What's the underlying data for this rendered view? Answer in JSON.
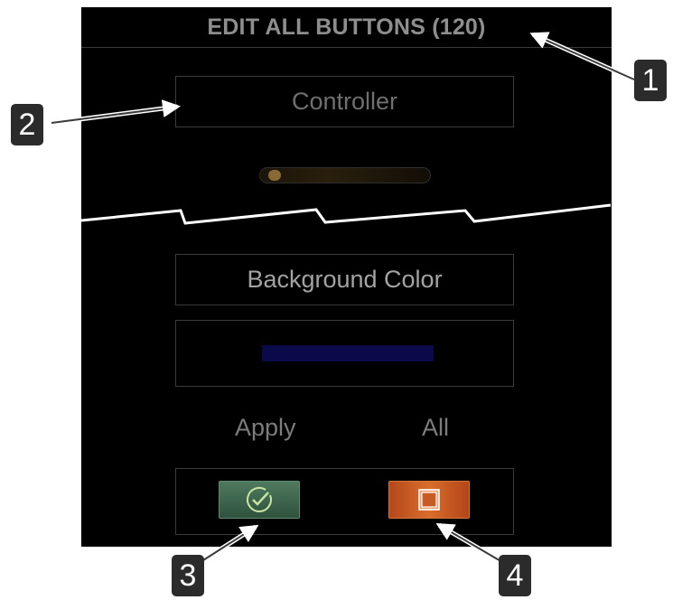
{
  "dialog": {
    "title": "EDIT ALL BUTTONS (120)",
    "controller_label": "Controller",
    "opacity_slider_level": 0.04,
    "background_color_label": "Background Color",
    "background_color_value": "#0a0a4a",
    "apply_label": "Apply",
    "all_label": "All",
    "confirm_icon": "check-circle-icon",
    "select_all_icon": "square-icon"
  },
  "callouts": [
    "1",
    "2",
    "3",
    "4"
  ],
  "colors": {
    "panel_bg": "#000000",
    "confirm_button": "#3f6a4f",
    "all_button": "#c85a24",
    "callout_bg": "#2b2b2b"
  }
}
